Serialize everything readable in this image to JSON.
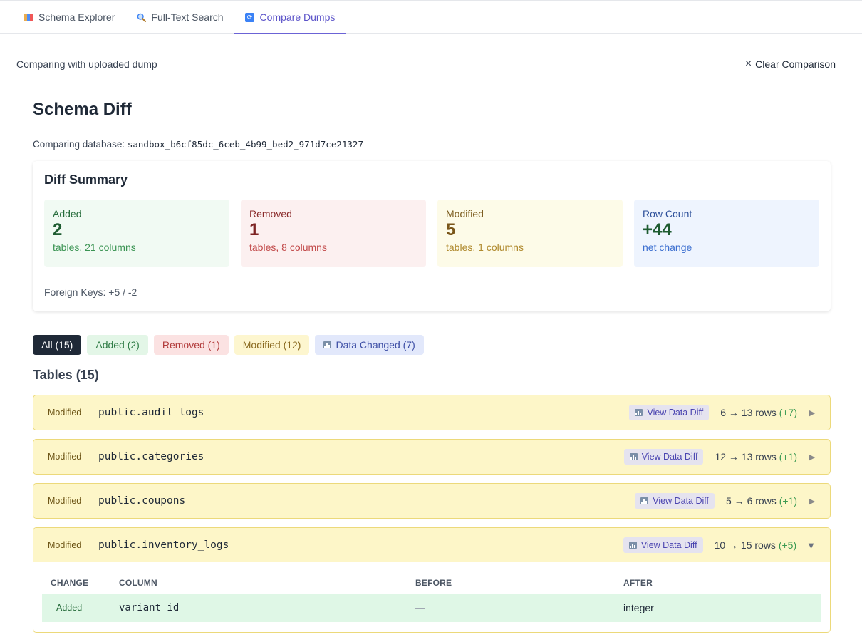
{
  "tabs": [
    {
      "label": "Schema Explorer",
      "icon": "chart-icon"
    },
    {
      "label": "Full-Text Search",
      "icon": "search-icon"
    },
    {
      "label": "Compare Dumps",
      "icon": "sync-icon",
      "active": true
    }
  ],
  "comparison": {
    "status": "Comparing with uploaded dump",
    "clear_label": "Clear Comparison"
  },
  "page": {
    "title": "Schema Diff",
    "subtitle_prefix": "Comparing database:",
    "database": "sandbox_b6cf85dc_6ceb_4b99_bed2_971d7ce21327"
  },
  "summary": {
    "title": "Diff Summary",
    "added": {
      "label": "Added",
      "value": "2",
      "sub": "tables, 21 columns"
    },
    "removed": {
      "label": "Removed",
      "value": "1",
      "sub": "tables, 8 columns"
    },
    "modified": {
      "label": "Modified",
      "value": "5",
      "sub": "tables, 1 columns"
    },
    "rowcount": {
      "label": "Row Count",
      "value": "+44",
      "sub": "net change"
    },
    "foreign_keys": "Foreign Keys: +5 / -2"
  },
  "filters": {
    "all": "All (15)",
    "added": "Added (2)",
    "removed": "Removed (1)",
    "modified": "Modified (12)",
    "data_changed": "Data Changed (7)"
  },
  "tables_title": "Tables (15)",
  "view_data_diff_label": "View Data Diff",
  "tables": [
    {
      "status": "Modified",
      "name": "public.audit_logs",
      "rows": "6 → 13 rows",
      "delta": "(+7)"
    },
    {
      "status": "Modified",
      "name": "public.categories",
      "rows": "12 → 13 rows",
      "delta": "(+1)"
    },
    {
      "status": "Modified",
      "name": "public.coupons",
      "rows": "5 → 6 rows",
      "delta": "(+1)"
    },
    {
      "status": "Modified",
      "name": "public.inventory_logs",
      "rows": "10 → 15 rows",
      "delta": "(+5)"
    }
  ],
  "column_table": {
    "headers": [
      "CHANGE",
      "COLUMN",
      "BEFORE",
      "AFTER"
    ],
    "rows": [
      {
        "change": "Added",
        "column": "variant_id",
        "before": "—",
        "after": "integer"
      }
    ]
  },
  "colors": {
    "accent": "#5b53c9",
    "modified_bg": "#fdf6c8",
    "added_bg": "#dff7e6"
  }
}
